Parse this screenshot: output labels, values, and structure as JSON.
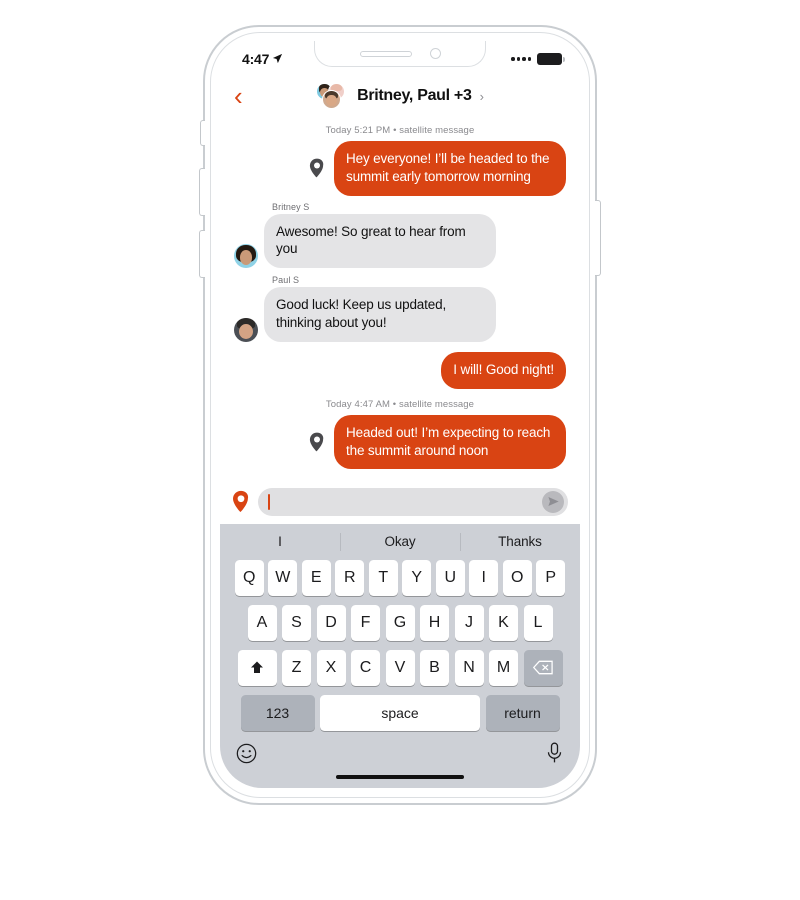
{
  "status_bar": {
    "time": "4:47",
    "location_arrow": "➤",
    "signal_dots": 4
  },
  "nav": {
    "back_icon": "‹",
    "title": "Britney, Paul +3",
    "chevron": "›"
  },
  "conversation": {
    "threads": [
      {
        "kind": "timestamp",
        "text": "Today 5:21 PM • satellite message"
      },
      {
        "kind": "sent",
        "has_pin": true,
        "text": "Hey everyone! I’ll be headed to the summit early tomorrow morning"
      },
      {
        "kind": "received",
        "sender": "Britney S",
        "avatar": "britney",
        "text": "Awesome! So great to hear from you"
      },
      {
        "kind": "received",
        "sender": "Paul S",
        "avatar": "paul",
        "text": "Good luck! Keep us updated, thinking about you!"
      },
      {
        "kind": "sent",
        "has_pin": false,
        "text": "I will! Good night!"
      },
      {
        "kind": "timestamp",
        "text": "Today 4:47 AM • satellite message"
      },
      {
        "kind": "sent",
        "has_pin": true,
        "text": "Headed out! I’m expecting to reach the summit around noon"
      }
    ]
  },
  "input_bar": {
    "pin_icon": "location-pin",
    "value": "",
    "placeholder": "",
    "send_icon": "send-arrow"
  },
  "keyboard": {
    "predictions": [
      "I",
      "Okay",
      "Thanks"
    ],
    "row1": [
      "Q",
      "W",
      "E",
      "R",
      "T",
      "Y",
      "U",
      "I",
      "O",
      "P"
    ],
    "row2": [
      "A",
      "S",
      "D",
      "F",
      "G",
      "H",
      "J",
      "K",
      "L"
    ],
    "row3": [
      "Z",
      "X",
      "C",
      "V",
      "B",
      "N",
      "M"
    ],
    "shift_label": "⬆",
    "backspace_label": "⌫",
    "numbers_label": "123",
    "space_label": "space",
    "return_label": "return",
    "emoji_icon": "emoji-smiley",
    "mic_icon": "microphone"
  },
  "colors": {
    "accent_orange": "#d94413",
    "received_bubble": "#e4e4e6",
    "keyboard_bg": "#cdd0d6",
    "key_function": "#adb2ba"
  }
}
